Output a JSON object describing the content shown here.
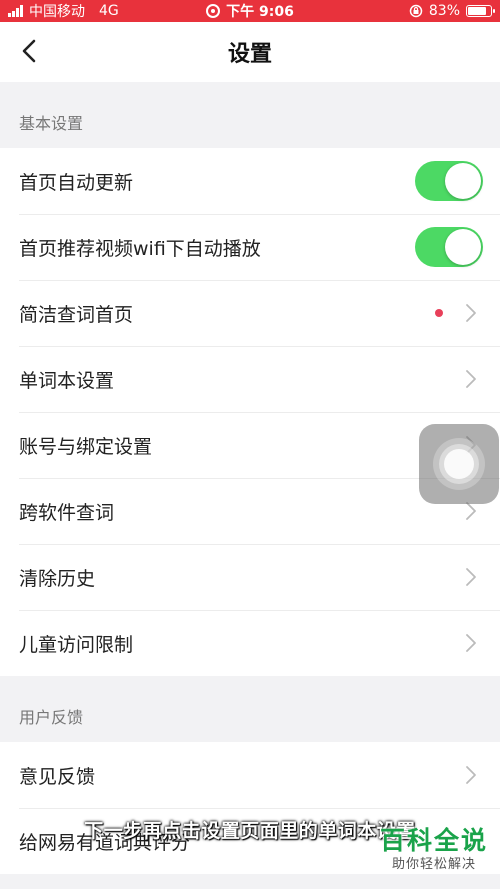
{
  "status_bar": {
    "carrier": "中国移动",
    "network": "4G",
    "time": "下午 9:06",
    "battery_percent": "83%",
    "battery_level": 0.83
  },
  "nav": {
    "title": "设置"
  },
  "basic_section": {
    "header": "基本设置",
    "items": [
      {
        "label": "首页自动更新",
        "control": "toggle",
        "on": true
      },
      {
        "label": "首页推荐视频wifi下自动播放",
        "control": "toggle",
        "on": true
      },
      {
        "label": "简洁查词首页",
        "control": "chevron",
        "badge": "red-dot"
      },
      {
        "label": "单词本设置",
        "control": "chevron"
      },
      {
        "label": "账号与绑定设置",
        "control": "chevron"
      },
      {
        "label": "跨软件查词",
        "control": "chevron"
      },
      {
        "label": "清除历史",
        "control": "chevron"
      },
      {
        "label": "儿童访问限制",
        "control": "chevron"
      }
    ]
  },
  "feedback_section": {
    "header": "用户反馈",
    "items": [
      {
        "label": "意见反馈",
        "control": "chevron"
      },
      {
        "label": "给网易有道词典评分",
        "control": "chevron"
      }
    ]
  },
  "overlay": {
    "subtitle": "下一步再点击设置页面里的单词本设置",
    "watermark_title": "百科全说",
    "watermark_subtitle": "助你轻松解决"
  },
  "colors": {
    "status_bar": "#e8323c",
    "toggle_on": "#4cd964",
    "badge_dot": "#e8405a",
    "watermark": "#1aa34a"
  },
  "icons": [
    "back-arrow-icon",
    "chevron-right-icon",
    "recording-icon",
    "lock-rotation-icon",
    "battery-icon",
    "signal-icon",
    "assistive-touch-icon"
  ]
}
